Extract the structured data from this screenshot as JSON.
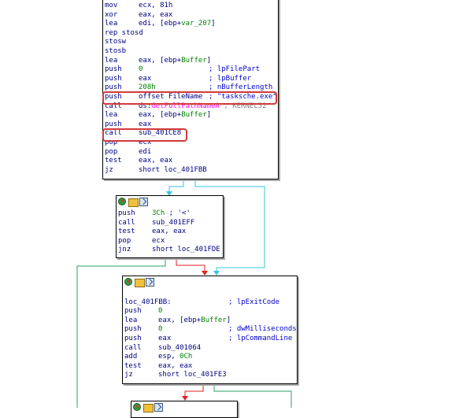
{
  "block1": {
    "lines": [
      {
        "mn": "mov",
        "op": "ecx, 81h"
      },
      {
        "mn": "xor",
        "op": "eax, eax"
      },
      {
        "mn": "lea",
        "op": "edi, [ebp+",
        "op_var": "var_207",
        "op_end": "]"
      },
      {
        "mn": "rep stosd",
        "op": ""
      },
      {
        "mn": "stosw",
        "op": ""
      },
      {
        "mn": "stosb",
        "op": ""
      },
      {
        "mn": "lea",
        "op": "eax, [ebp+",
        "op_var": "Buffer",
        "op_end": "]"
      },
      {
        "mn": "push",
        "op_num": "0",
        "comment": "; lpFilePart"
      },
      {
        "mn": "push",
        "op": "eax",
        "comment": "; lpBuffer"
      },
      {
        "mn": "push",
        "op_num": "208h",
        "comment": "; nBufferLength"
      },
      {
        "mn": "push",
        "op": "offset FileName",
        "comment": "; \"tasksche.exe\""
      },
      {
        "mn": "call",
        "op": "ds:",
        "op_imp": "GetFullPathNameA",
        "comment_gray": "; KERNEL32"
      },
      {
        "mn": "lea",
        "op": "eax, [ebp+",
        "op_var": "Buffer",
        "op_end": "]"
      },
      {
        "mn": "push",
        "op": "eax"
      },
      {
        "mn": "call",
        "op": "sub_401CE8"
      },
      {
        "mn": "pop",
        "op": "ecx"
      },
      {
        "mn": "pop",
        "op": "edi"
      },
      {
        "mn": "test",
        "op": "eax, eax"
      },
      {
        "mn": "jz",
        "op": "short loc_401FBB"
      }
    ]
  },
  "block2": {
    "lines": [
      {
        "mn": "push",
        "op_num": "3Ch",
        "comment_plain": " ; '<'"
      },
      {
        "mn": "call",
        "op": "sub_401EFF"
      },
      {
        "mn": "test",
        "op": "eax, eax"
      },
      {
        "mn": "pop",
        "op": "ecx"
      },
      {
        "mn": "jnz",
        "op": "short loc_401FDE"
      }
    ]
  },
  "block3": {
    "lines": [
      {
        "mn": "",
        "op": ""
      },
      {
        "mn": "loc_401FBB:",
        "op": "",
        "comment": "; lpExitCode"
      },
      {
        "mn": "push",
        "op_num": "0"
      },
      {
        "mn": "lea",
        "op": "eax, [ebp+",
        "op_var": "Buffer",
        "op_end": "]"
      },
      {
        "mn": "push",
        "op_num": "0",
        "comment": "; dwMilliseconds"
      },
      {
        "mn": "push",
        "op": "eax",
        "comment": "; lpCommandLine"
      },
      {
        "mn": "call",
        "op": "sub_401064"
      },
      {
        "mn": "add",
        "op": "esp, ",
        "op_num_tail": "0Ch"
      },
      {
        "mn": "test",
        "op": "eax, eax"
      },
      {
        "mn": "jz",
        "op": "short loc_401FE3"
      }
    ]
  },
  "colors": {
    "true_edge": "#34c7dc",
    "false_edge": "#e02020",
    "green_edge": "#2aa060",
    "highlight": "#d23a3a"
  }
}
